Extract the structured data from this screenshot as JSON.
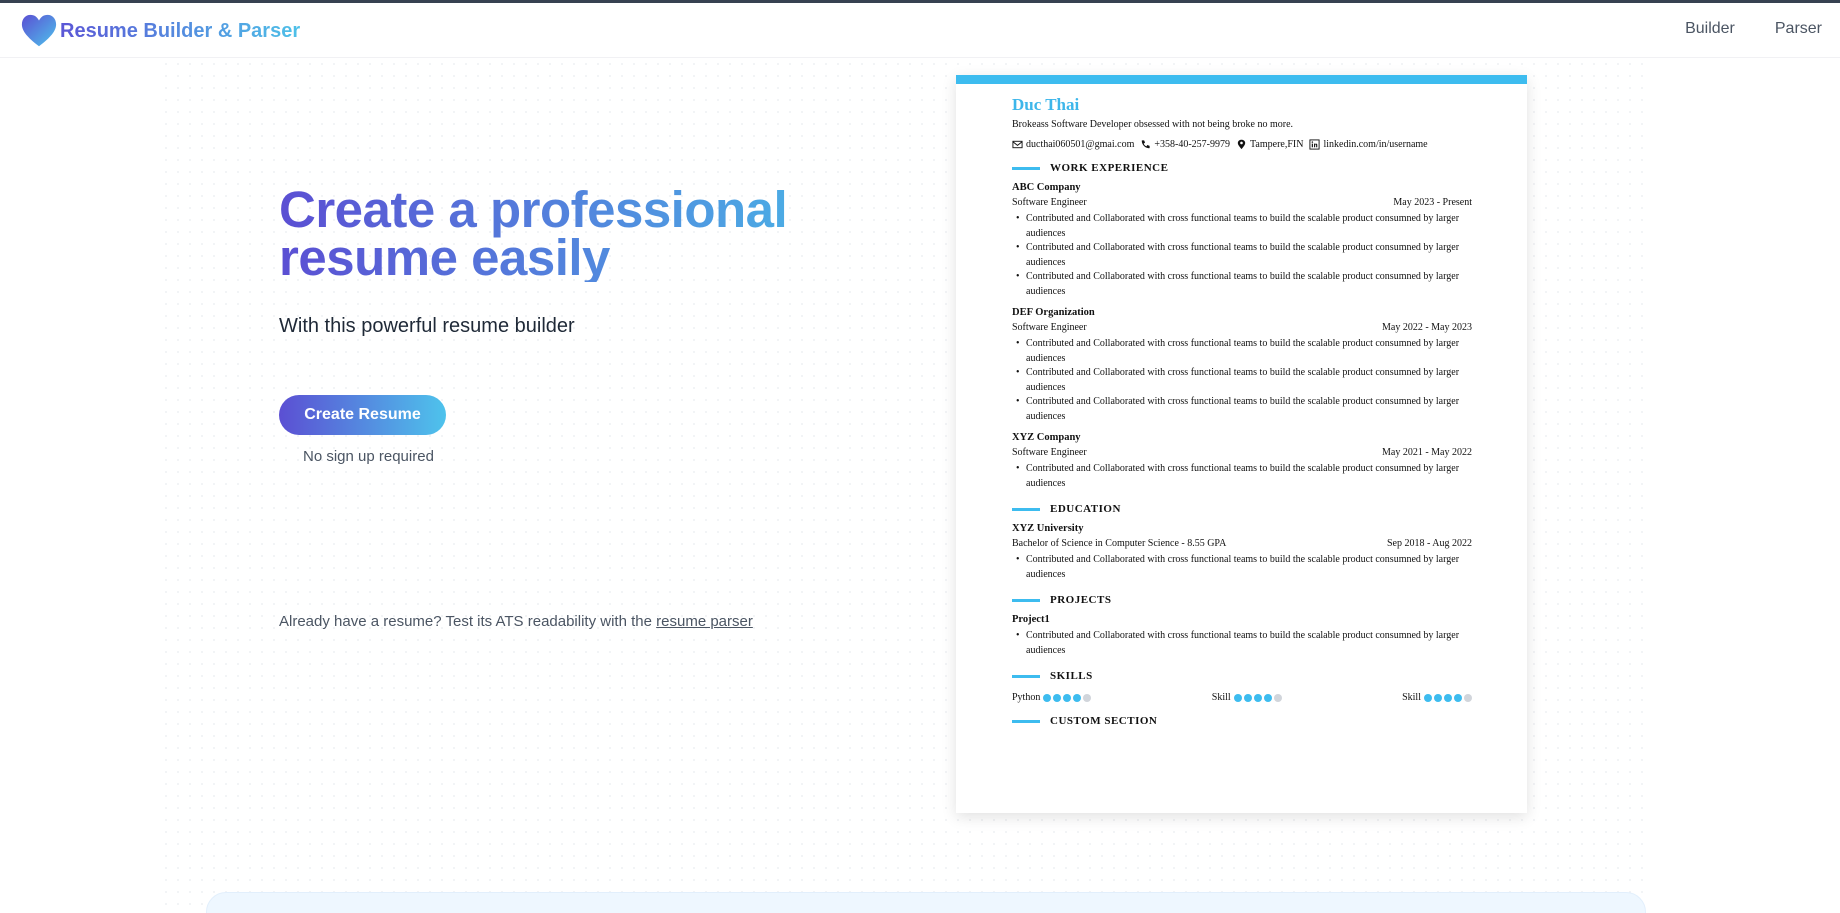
{
  "header": {
    "logo_text": "Resume Builder & Parser",
    "nav": [
      {
        "label": "Builder"
      },
      {
        "label": "Parser"
      }
    ]
  },
  "hero": {
    "title": "Create a professional resume easily",
    "subtitle": "With this powerful resume builder",
    "cta_label": "Create Resume",
    "note": "No sign up required",
    "already_text": "Already have a resume? Test its ATS readability with the",
    "parser_link": "resume parser"
  },
  "resume": {
    "accent": "#3dbcef",
    "name": "Duc Thai",
    "summary": "Brokeass Software Developer obsessed with not being broke no more.",
    "contact": {
      "email": "ducthai060501@gmai.com",
      "phone": "+358-40-257-9979",
      "location": "Tampere,FIN",
      "linkedin": "linkedin.com/in/username"
    },
    "sections": {
      "work": "WORK EXPERIENCE",
      "education": "EDUCATION",
      "projects": "PROJECTS",
      "skills": "SKILLS",
      "custom": "CUSTOM SECTION"
    },
    "bullet_text": "Contributed and Collaborated with cross functional teams to build the scalable product consumned by larger audiences",
    "work": [
      {
        "company": "ABC Company",
        "role": "Software Engineer",
        "date": "May 2023 - Present"
      },
      {
        "company": "DEF Organization",
        "role": "Software Engineer",
        "date": "May 2022 - May 2023"
      },
      {
        "company": "XYZ Company",
        "role": "Software Engineer",
        "date": "May 2021 - May 2022"
      }
    ],
    "education": {
      "school": "XYZ University",
      "degree": "Bachelor of Science in Computer Science - 8.55 GPA",
      "date": "Sep 2018 - Aug 2022"
    },
    "project": {
      "name": "Project1"
    },
    "skills": [
      {
        "name": "Python",
        "level": 4,
        "max": 5
      },
      {
        "name": "Skill",
        "level": 4,
        "max": 5
      },
      {
        "name": "Skill",
        "level": 4,
        "max": 5
      }
    ]
  },
  "colors": {
    "gradient_start": "#5b4fd3",
    "gradient_end": "#4ec3ec"
  }
}
